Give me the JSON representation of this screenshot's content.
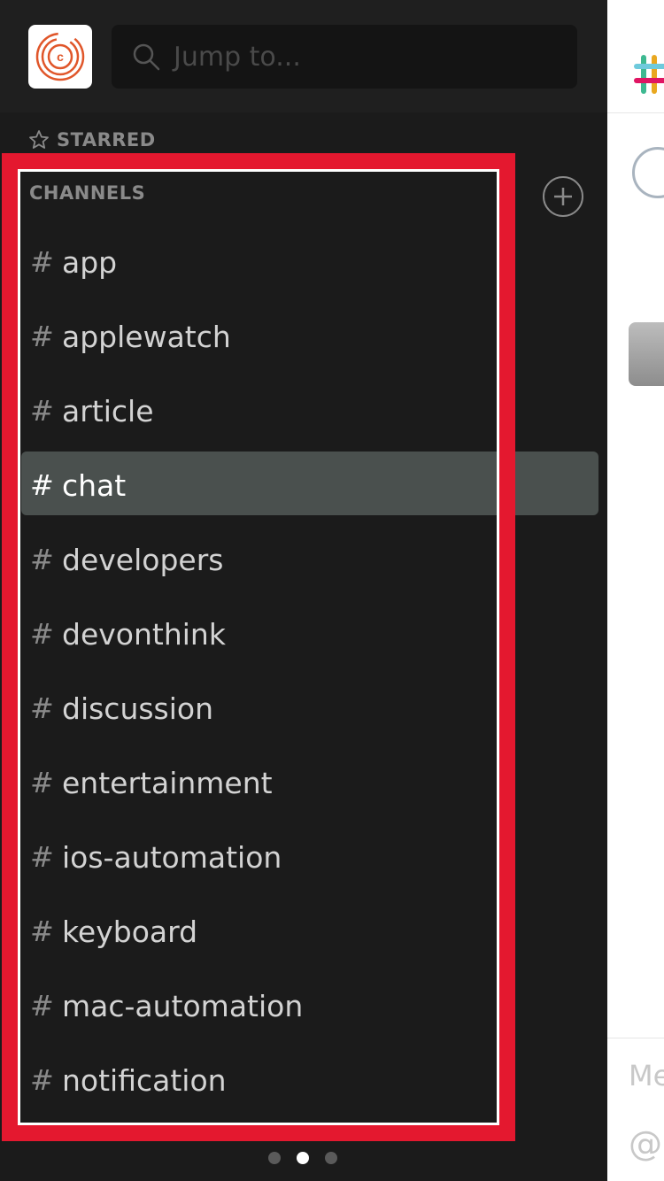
{
  "search": {
    "placeholder": "Jump to..."
  },
  "sections": {
    "starred_label": "STARRED",
    "channels_label": "CHANNELS"
  },
  "channels": [
    {
      "label": "#",
      "name": "app"
    },
    {
      "label": "#",
      "name": "applewatch"
    },
    {
      "label": "#",
      "name": "article"
    },
    {
      "label": "#",
      "name": "chat",
      "active": true
    },
    {
      "label": "#",
      "name": "developers"
    },
    {
      "label": "#",
      "name": "devonthink"
    },
    {
      "label": "#",
      "name": "discussion"
    },
    {
      "label": "#",
      "name": "entertainment"
    },
    {
      "label": "#",
      "name": "ios-automation"
    },
    {
      "label": "#",
      "name": "keyboard"
    },
    {
      "label": "#",
      "name": "mac-automation"
    },
    {
      "label": "#",
      "name": "notification"
    }
  ],
  "right_panel": {
    "message_placeholder": "Me",
    "at_symbol": "@"
  },
  "pager": {
    "count": 3,
    "active_index": 1
  },
  "colors": {
    "highlight_frame": "#e4182f",
    "selected_row": "#4a504e",
    "logo_accent": "#e0562a"
  },
  "icons": {
    "workspace": "workspace-logo-icon",
    "search": "search-icon",
    "starred": "star-icon",
    "add_channel": "plus-circle-icon"
  }
}
